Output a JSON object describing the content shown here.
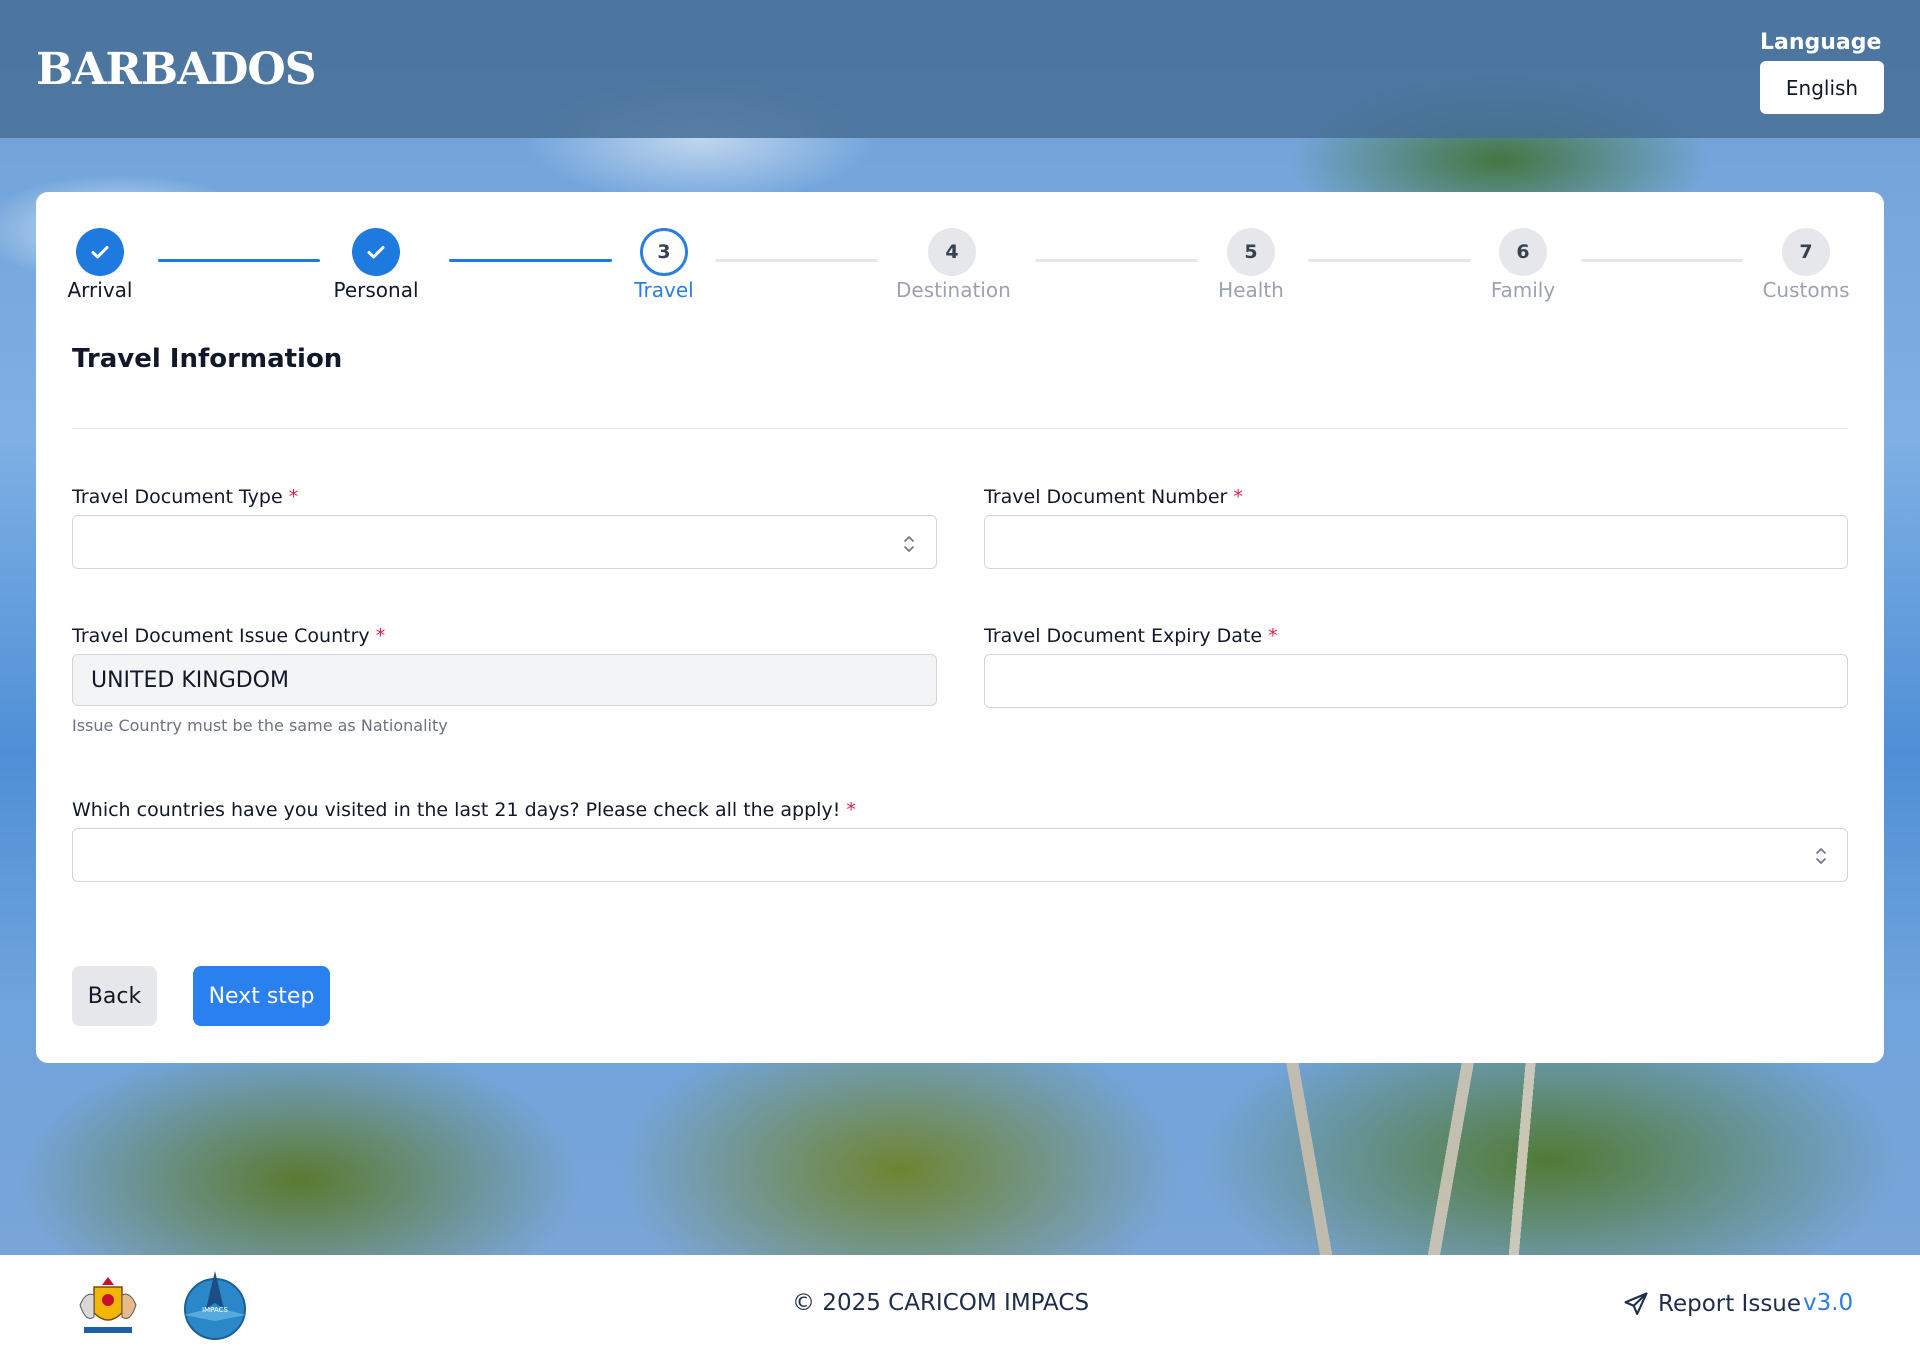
{
  "header": {
    "logo_text": "BARBADOS",
    "language_label": "Language",
    "language_value": "English"
  },
  "stepper": {
    "steps": [
      {
        "number": "",
        "label": "Arrival",
        "state": "done"
      },
      {
        "number": "",
        "label": "Personal",
        "state": "done"
      },
      {
        "number": "3",
        "label": "Travel",
        "state": "active"
      },
      {
        "number": "4",
        "label": "Destination",
        "state": "todo"
      },
      {
        "number": "5",
        "label": "Health",
        "state": "todo"
      },
      {
        "number": "6",
        "label": "Family",
        "state": "todo"
      },
      {
        "number": "7",
        "label": "Customs",
        "state": "todo"
      }
    ]
  },
  "form": {
    "title": "Travel Information",
    "doc_type_label": "Travel Document Type",
    "doc_type_value": "",
    "doc_number_label": "Travel Document Number",
    "doc_number_value": "",
    "issue_country_label": "Travel Document Issue Country",
    "issue_country_value": "UNITED KINGDOM",
    "issue_country_hint": "Issue Country must be the same as Nationality",
    "expiry_label": "Travel Document Expiry Date",
    "expiry_value": "",
    "visited_label": "Which countries have you visited in the last 21 days? Please check all the apply!",
    "visited_value": "",
    "required_mark": "*",
    "back_label": "Back",
    "next_label": "Next step"
  },
  "footer": {
    "copyright": "© 2025 CARICOM IMPACS",
    "report_label": "Report Issue",
    "version": "v3.0",
    "impacs_logo_text": "IMPACS"
  },
  "colors": {
    "primary": "#2b80f0",
    "step_done": "#1f7ae0",
    "required": "#e11d48",
    "footer_text": "#1f2d4d"
  }
}
